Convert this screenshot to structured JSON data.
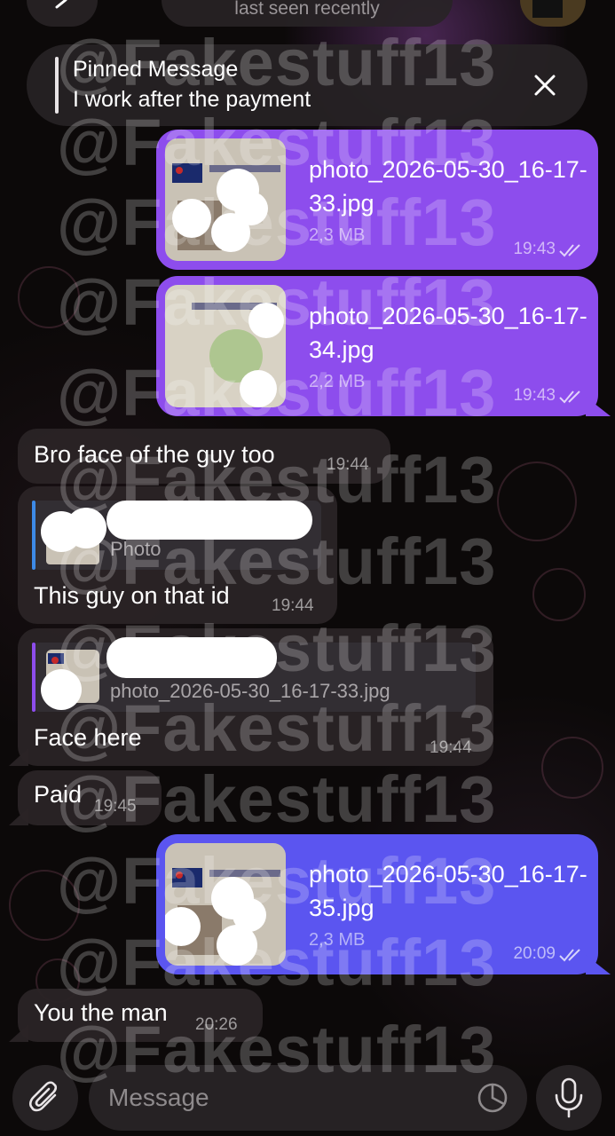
{
  "header": {
    "status": "last seen recently"
  },
  "pinned": {
    "title": "Pinned Message",
    "text": "I work after the payment"
  },
  "messages": {
    "file1": {
      "name": "photo_2026-05-30_16-17-33.jpg",
      "size": "2,3 MB",
      "time": "19:43"
    },
    "file2": {
      "name": "photo_2026-05-30_16-17-34.jpg",
      "size": "2,2 MB",
      "time": "19:43"
    },
    "msg1": {
      "text": "Bro face of the guy too",
      "time": "19:44"
    },
    "msg2": {
      "reply_label": "Photo",
      "text": "This guy on that id",
      "time": "19:44"
    },
    "msg3": {
      "reply_label": "photo_2026-05-30_16-17-33.jpg",
      "text": "Face here",
      "time": "19:44"
    },
    "msg4": {
      "text": "Paid",
      "time": "19:45"
    },
    "file3": {
      "name": "photo_2026-05-30_16-17-35.jpg",
      "size": "2,3 MB",
      "time": "20:09"
    },
    "msg5": {
      "text": "You the man",
      "time": "20:26"
    }
  },
  "input": {
    "placeholder": "Message"
  },
  "watermark": "@Fakestuff13",
  "colors": {
    "outgoing_purple": "#8d4ded",
    "outgoing_blue": "#5b55f0",
    "incoming": "#2a2426",
    "reply_bar_blue": "#3d8ae6"
  },
  "icons": [
    "back-chevron-icon",
    "close-icon",
    "read-ticks-icon",
    "attach-paperclip-icon",
    "sticker-icon",
    "microphone-icon"
  ]
}
